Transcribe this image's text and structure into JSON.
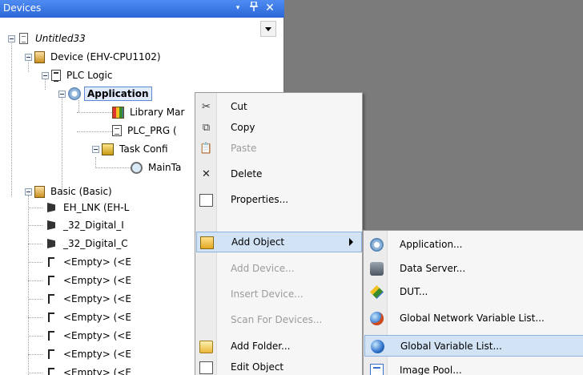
{
  "panel": {
    "title": "Devices",
    "dropdown_glyph": "▾",
    "pin_glyph": "ᵖ",
    "close_glyph": "✕"
  },
  "tree": {
    "project": "Untitled33",
    "device": "Device (EHV-CPU1102)",
    "plc_logic": "PLC Logic",
    "application": "Application",
    "library": "Library Mar",
    "plc_prg": "PLC_PRG (",
    "task_config": "Task Confi",
    "main_task": "MainTa",
    "basic": "Basic (Basic)",
    "eh_lnk": "EH_LNK (EH-L",
    "digital_in": "_32_Digital_I",
    "digital_out": "_32_Digital_C",
    "empty_slots": [
      "<Empty> (<E",
      "<Empty> (<E",
      "<Empty> (<E",
      "<Empty> (<E",
      "<Empty> (<E",
      "<Empty> (<E",
      "<Empty> (<E"
    ]
  },
  "context_menu": {
    "items": [
      {
        "label": "Cut",
        "icon": "scissors-icon",
        "disabled": false
      },
      {
        "label": "Copy",
        "icon": "copy-icon",
        "disabled": false
      },
      {
        "label": "Paste",
        "icon": "paste-icon",
        "disabled": true
      },
      {
        "label": "Delete",
        "icon": "delete-icon",
        "disabled": false
      },
      {
        "label": "Properties...",
        "icon": "properties-icon",
        "disabled": false
      },
      {
        "label": "Add Object",
        "icon": "add-object-icon",
        "disabled": false,
        "submenu": true,
        "highlighted": true
      },
      {
        "label": "Add Device...",
        "icon": "",
        "disabled": true
      },
      {
        "label": "Insert Device...",
        "icon": "",
        "disabled": true
      },
      {
        "label": "Scan For Devices...",
        "icon": "",
        "disabled": true
      },
      {
        "label": "Add Folder...",
        "icon": "folder-icon",
        "disabled": false
      },
      {
        "label": "Edit Object",
        "icon": "edit-object-icon",
        "disabled": false
      }
    ]
  },
  "submenu": {
    "items": [
      {
        "label": "Application...",
        "icon": "application-icon"
      },
      {
        "label": "Data Server...",
        "icon": "data-server-icon"
      },
      {
        "label": "DUT...",
        "icon": "dut-icon"
      },
      {
        "label": "Global Network Variable List...",
        "icon": "network-globe-icon"
      },
      {
        "label": "Global Variable List...",
        "icon": "globe-icon",
        "highlighted": true
      },
      {
        "label": "Image Pool...",
        "icon": "image-pool-icon"
      }
    ]
  },
  "colors": {
    "header_blue": "#2c67d8",
    "menu_highlight": "#d2e3f6",
    "background_gray": "#7b7b7b"
  }
}
